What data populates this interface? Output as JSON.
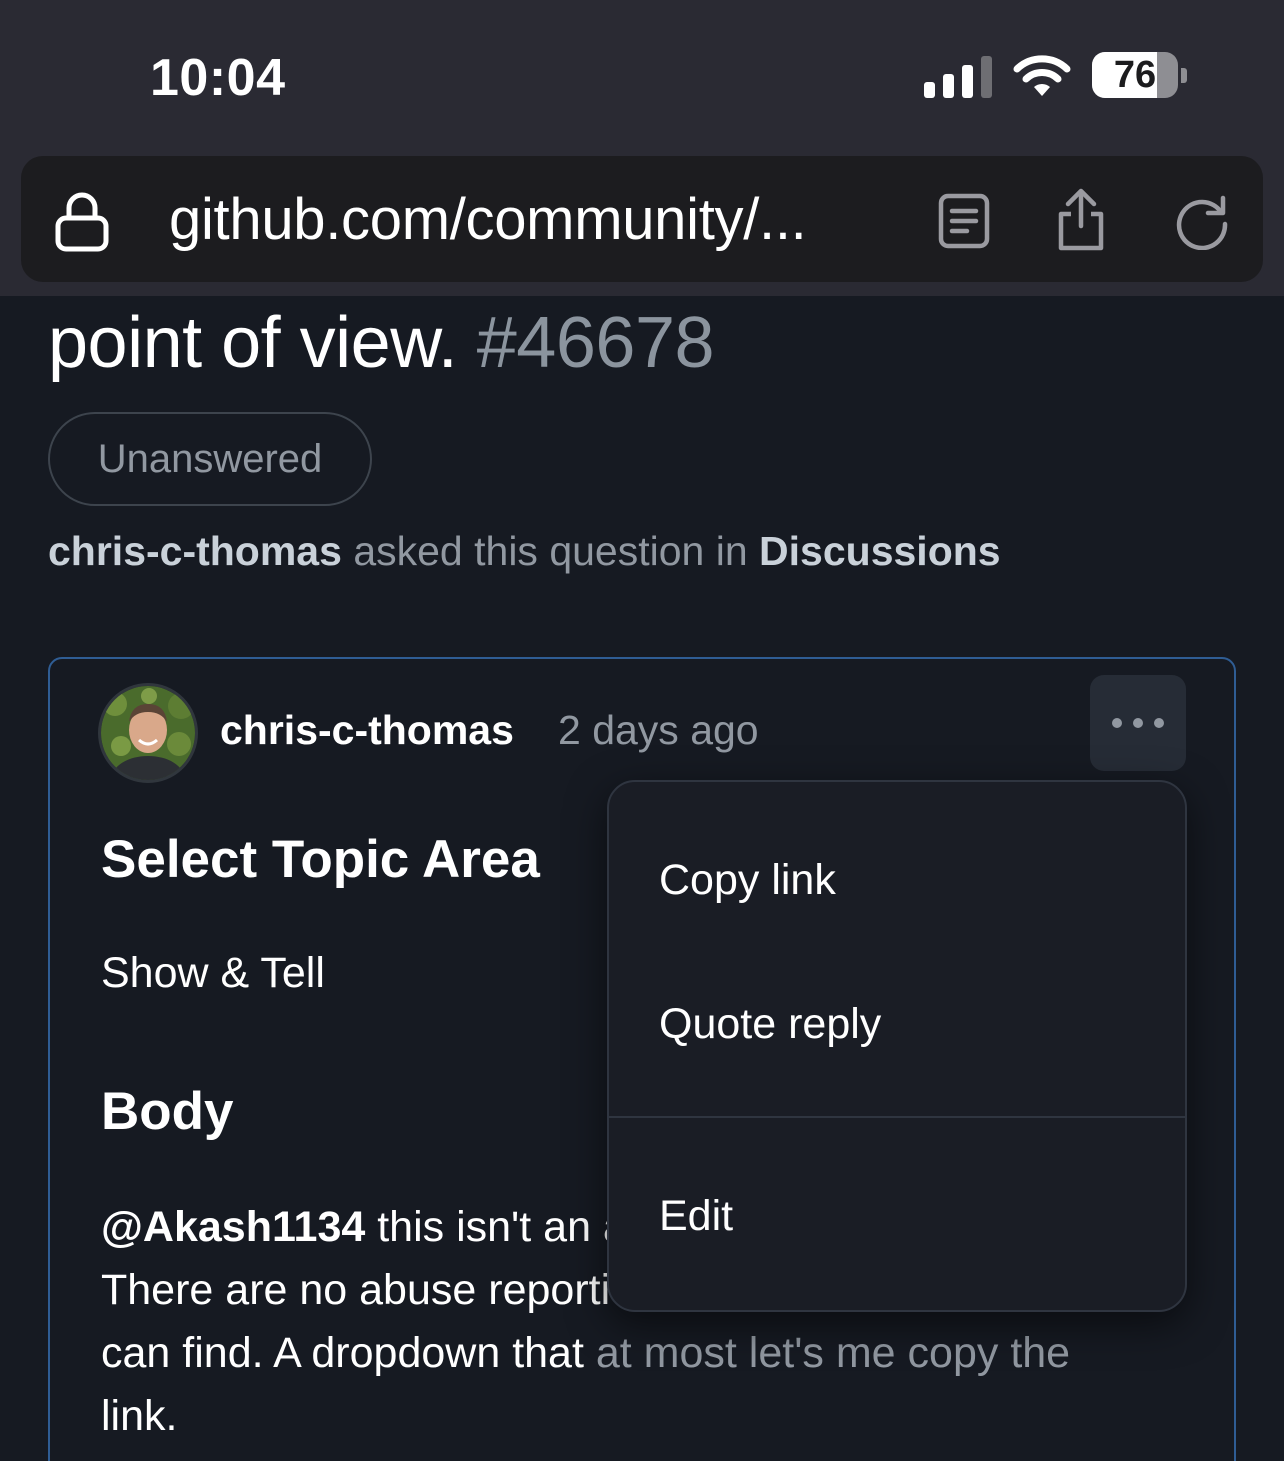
{
  "status_bar": {
    "time": "10:04",
    "battery_level": "76",
    "battery_fraction": 0.76,
    "icons": [
      "cellular-signal-icon",
      "wifi-icon",
      "battery-icon"
    ]
  },
  "browser": {
    "url": "github.com/community/...",
    "icons": [
      "lock-icon",
      "reader-mode-icon",
      "share-icon",
      "reload-icon"
    ]
  },
  "discussion": {
    "title_tail": "point of view.",
    "number": "#46678",
    "state": "Unanswered",
    "byline": {
      "author": "chris-c-thomas",
      "middle": "asked this question in",
      "category": "Discussions"
    }
  },
  "comment": {
    "author": "chris-c-thomas",
    "timestamp": "2 days ago",
    "topic_heading": "Select Topic Area",
    "topic_value": "Show & Tell",
    "body_heading": "Body",
    "body": {
      "mention": "@Akash1134",
      "line1_rest": " this isn't an a",
      "line2": "There are no abuse reporti",
      "line3_start": "can find. A dropdown that ",
      "line3_end": "at most let's me copy the",
      "line4": "link."
    }
  },
  "menu": {
    "items": [
      "Copy link",
      "Quote reply",
      "Edit"
    ]
  },
  "colors": {
    "background": "#161a22",
    "status_bar": "#2a2a33",
    "muted_text": "#9198a1",
    "card_border": "#2f5d94",
    "menu_background": "#1a1d25"
  }
}
